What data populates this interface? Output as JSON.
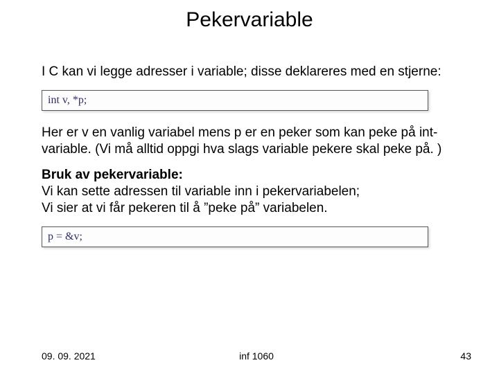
{
  "title": "Pekervariable",
  "para1": "I C kan vi legge adresser i variable; disse deklareres med en stjerne:",
  "code1": "int v, *p;",
  "para2": "Her er v en vanlig variabel mens p er en peker som kan peke på int-variable. (Vi må alltid oppgi hva slags variable pekere skal peke på. )",
  "para3_bold": "Bruk av pekervariable:",
  "para3_line2": "Vi kan sette adressen til variable inn i pekervariabelen;",
  "para3_line3": "Vi sier at vi får pekeren til å ”peke på” variabelen.",
  "code2": "p = &v;",
  "footer": {
    "date": "09. 09. 2021",
    "course": "inf 1060",
    "page": "43"
  }
}
